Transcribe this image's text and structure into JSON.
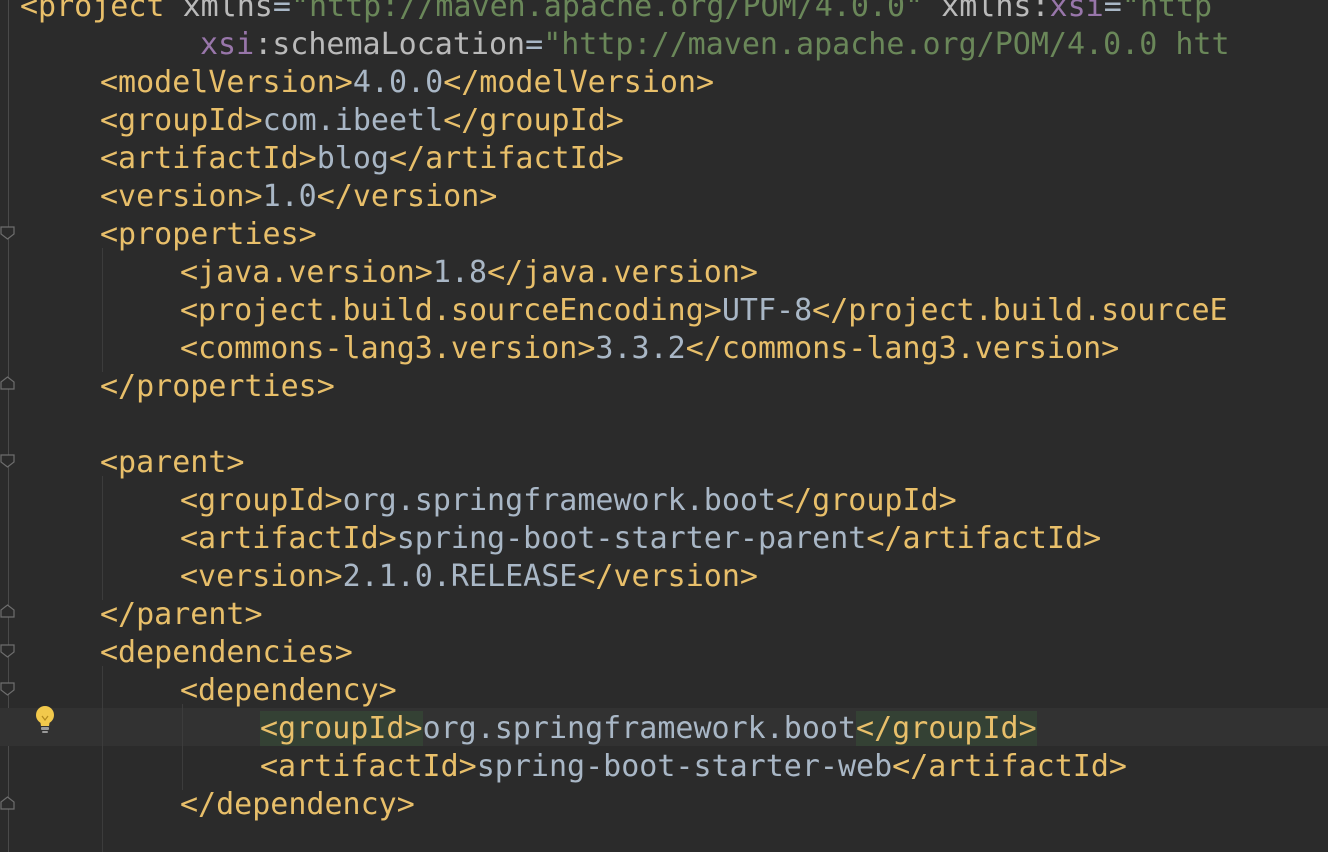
{
  "editor": {
    "lines": [
      {
        "indent": 0,
        "parts": [
          {
            "t": "tag",
            "v": "<project "
          },
          {
            "t": "attr",
            "v": "xmlns"
          },
          {
            "t": "txt",
            "v": "="
          },
          {
            "t": "val",
            "v": "\"http://maven.apache.org/POM/4.0.0\""
          },
          {
            "t": "txt",
            "v": " "
          },
          {
            "t": "attr",
            "v": "xmlns:"
          },
          {
            "t": "ns",
            "v": "xsi"
          },
          {
            "t": "txt",
            "v": "="
          },
          {
            "t": "val",
            "v": "\"http"
          }
        ]
      },
      {
        "indent": 9,
        "parts": [
          {
            "t": "ns",
            "v": "xsi"
          },
          {
            "t": "attr",
            "v": ":schemaLocation"
          },
          {
            "t": "txt",
            "v": "="
          },
          {
            "t": "val",
            "v": "\"http://maven.apache.org/POM/4.0.0 htt"
          }
        ]
      },
      {
        "indent": 4,
        "parts": [
          {
            "t": "tag",
            "v": "<modelVersion>"
          },
          {
            "t": "txt",
            "v": "4.0.0"
          },
          {
            "t": "tag",
            "v": "</modelVersion>"
          }
        ]
      },
      {
        "indent": 4,
        "parts": [
          {
            "t": "tag",
            "v": "<groupId>"
          },
          {
            "t": "txt",
            "v": "com.ibeetl"
          },
          {
            "t": "tag",
            "v": "</groupId>"
          }
        ]
      },
      {
        "indent": 4,
        "parts": [
          {
            "t": "tag",
            "v": "<artifactId>"
          },
          {
            "t": "txt",
            "v": "blog"
          },
          {
            "t": "tag",
            "v": "</artifactId>"
          }
        ]
      },
      {
        "indent": 4,
        "parts": [
          {
            "t": "tag",
            "v": "<version>"
          },
          {
            "t": "txt",
            "v": "1.0"
          },
          {
            "t": "tag",
            "v": "</version>"
          }
        ]
      },
      {
        "indent": 4,
        "parts": [
          {
            "t": "tag",
            "v": "<properties>"
          }
        ]
      },
      {
        "indent": 8,
        "parts": [
          {
            "t": "tag",
            "v": "<java.version>"
          },
          {
            "t": "txt",
            "v": "1.8"
          },
          {
            "t": "tag",
            "v": "</java.version>"
          }
        ]
      },
      {
        "indent": 8,
        "parts": [
          {
            "t": "tag",
            "v": "<project.build.sourceEncoding>"
          },
          {
            "t": "txt",
            "v": "UTF-8"
          },
          {
            "t": "tag",
            "v": "</project.build.sourceE"
          }
        ]
      },
      {
        "indent": 8,
        "parts": [
          {
            "t": "tag",
            "v": "<commons-lang3.version>"
          },
          {
            "t": "txt",
            "v": "3.3.2"
          },
          {
            "t": "tag",
            "v": "</commons-lang3.version>"
          }
        ]
      },
      {
        "indent": 4,
        "parts": [
          {
            "t": "tag",
            "v": "</properties>"
          }
        ]
      },
      {
        "indent": 0,
        "parts": []
      },
      {
        "indent": 4,
        "parts": [
          {
            "t": "tag",
            "v": "<parent>"
          }
        ]
      },
      {
        "indent": 8,
        "parts": [
          {
            "t": "tag",
            "v": "<groupId>"
          },
          {
            "t": "txt",
            "v": "org.springframework.boot"
          },
          {
            "t": "tag",
            "v": "</groupId>"
          }
        ]
      },
      {
        "indent": 8,
        "parts": [
          {
            "t": "tag",
            "v": "<artifactId>"
          },
          {
            "t": "txt",
            "v": "spring-boot-starter-parent"
          },
          {
            "t": "tag",
            "v": "</artifactId>"
          }
        ]
      },
      {
        "indent": 8,
        "parts": [
          {
            "t": "tag",
            "v": "<version>"
          },
          {
            "t": "txt",
            "v": "2.1.0.RELEASE"
          },
          {
            "t": "tag",
            "v": "</version>"
          }
        ]
      },
      {
        "indent": 4,
        "parts": [
          {
            "t": "tag",
            "v": "</parent>"
          }
        ]
      },
      {
        "indent": 4,
        "parts": [
          {
            "t": "tag",
            "v": "<dependencies>"
          }
        ]
      },
      {
        "indent": 8,
        "parts": [
          {
            "t": "tag",
            "v": "<dependency>"
          }
        ]
      },
      {
        "indent": 12,
        "parts": [
          {
            "t": "tag",
            "v": "<groupId>",
            "hl": true
          },
          {
            "t": "txt",
            "v": "org.springframework.boot"
          },
          {
            "t": "tag",
            "v": "</groupId>",
            "hl": true
          }
        ]
      },
      {
        "indent": 12,
        "parts": [
          {
            "t": "tag",
            "v": "<artifactId>"
          },
          {
            "t": "txt",
            "v": "spring-boot-starter-web"
          },
          {
            "t": "tag",
            "v": "</artifactId>"
          }
        ]
      },
      {
        "indent": 8,
        "parts": [
          {
            "t": "tag",
            "v": "</dependency>"
          }
        ]
      }
    ]
  },
  "icons": {
    "bulb": "intention-bulb-icon",
    "fold": "fold-marker-icon"
  },
  "colors": {
    "background": "#2b2b2b",
    "tag": "#e8bf6a",
    "text": "#a9b7c6",
    "attribute": "#bababa",
    "namespace": "#9876aa",
    "string": "#6a8759",
    "caret_row": "#323232",
    "match_highlight": "#344134"
  }
}
